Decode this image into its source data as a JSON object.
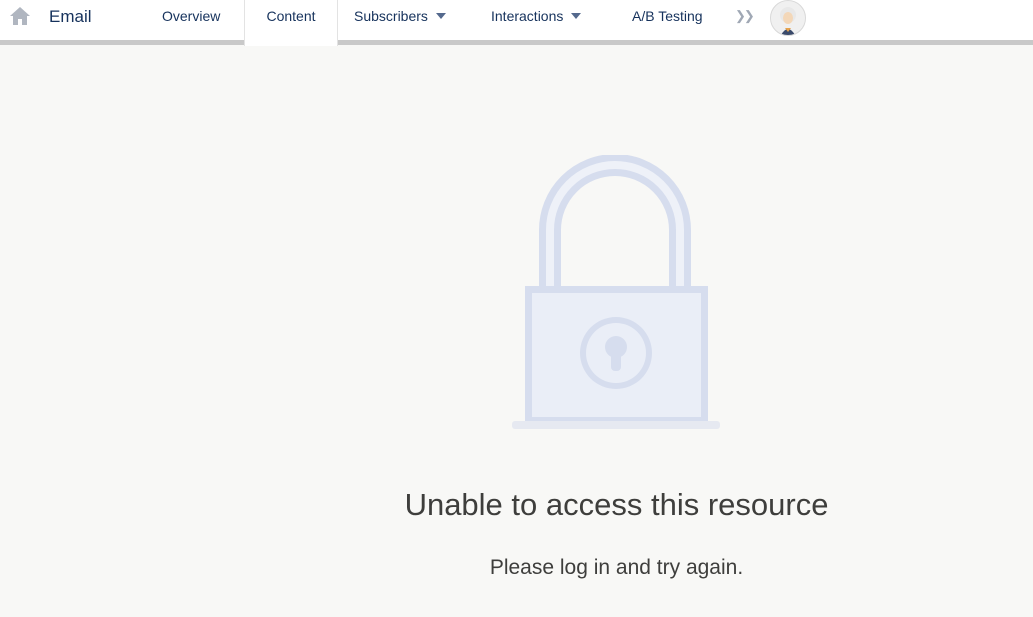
{
  "topbar": {
    "app_name": "Email",
    "tabs": [
      {
        "label": "Overview",
        "has_dropdown": false,
        "active": false
      },
      {
        "label": "Content",
        "has_dropdown": false,
        "active": true
      },
      {
        "label": "Subscribers",
        "has_dropdown": true,
        "active": false
      },
      {
        "label": "Interactions",
        "has_dropdown": true,
        "active": false
      },
      {
        "label": "A/B Testing",
        "has_dropdown": false,
        "active": false
      }
    ],
    "more_icon": "double-chevron-right-icon",
    "home_icon": "home-icon",
    "avatar_icon": "user-avatar-icon"
  },
  "main": {
    "illustration": "padlock-icon",
    "title": "Unable to access this resource",
    "message": "Please log in and try again."
  },
  "colors": {
    "nav_text": "#16325c",
    "lock": "#d6ddee",
    "lock_fill": "#eaeef7",
    "page_bg": "#f8f8f6"
  }
}
